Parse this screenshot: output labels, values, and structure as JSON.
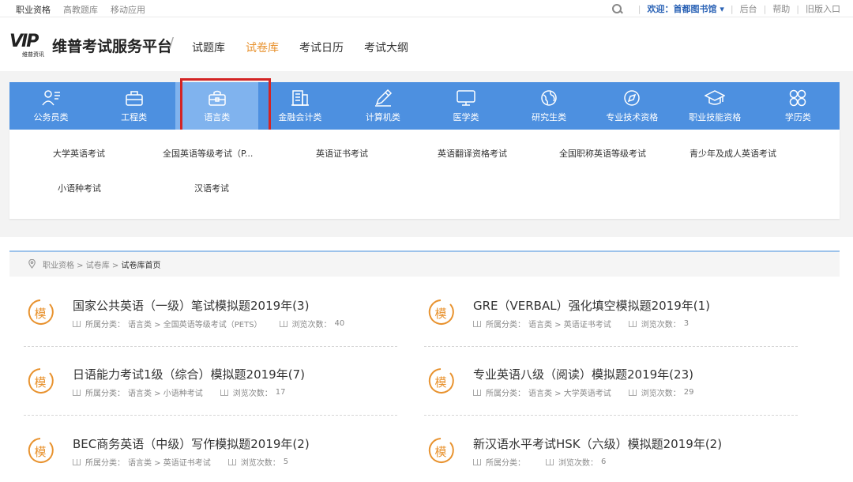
{
  "topbar": {
    "links": [
      "职业资格",
      "高教题库",
      "移动应用"
    ],
    "welcome": "欢迎：首都图书馆 ▾",
    "right_links": [
      "后台",
      "帮助",
      "旧版入口"
    ]
  },
  "header": {
    "logo_text": "VIP",
    "logo_sub": "维普资讯",
    "title": "维普考试服务平台",
    "slash": "/",
    "nav": [
      "试题库",
      "试卷库",
      "考试日历",
      "考试大纲"
    ],
    "nav_active_index": 1
  },
  "categories": {
    "items": [
      {
        "label": "公务员类",
        "icon": "person-list-icon"
      },
      {
        "label": "工程类",
        "icon": "toolbox-icon"
      },
      {
        "label": "语言类",
        "icon": "briefcase-icon"
      },
      {
        "label": "金融会计类",
        "icon": "bank-icon"
      },
      {
        "label": "计算机类",
        "icon": "pencil-icon"
      },
      {
        "label": "医学类",
        "icon": "monitor-icon"
      },
      {
        "label": "研究生类",
        "icon": "globe-icon"
      },
      {
        "label": "专业技术资格",
        "icon": "compass-icon"
      },
      {
        "label": "职业技能资格",
        "icon": "graduation-cap-icon"
      },
      {
        "label": "学历类",
        "icon": "four-circles-icon"
      }
    ],
    "selected_index": 2,
    "subcategories": [
      "大学英语考试",
      "全国英语等级考试（P...",
      "英语证书考试",
      "英语翻译资格考试",
      "全国职称英语等级考试",
      "青少年及成人英语考试",
      "小语种考试",
      "汉语考试"
    ]
  },
  "breadcrumb": {
    "items": [
      "职业资格",
      "试卷库"
    ],
    "current": "试卷库首页",
    "sep": " > "
  },
  "papers": {
    "badge_char": "模",
    "cat_label": "所属分类：",
    "views_label": "浏览次数：",
    "items": [
      {
        "title": "国家公共英语（一级）笔试模拟题2019年(3)",
        "category": "语言类 > 全国英语等级考试（PETS）",
        "views": "40"
      },
      {
        "title": "GRE（VERBAL）强化填空模拟题2019年(1)",
        "category": "语言类 > 英语证书考试",
        "views": "3"
      },
      {
        "title": "日语能力考试1级（综合）模拟题2019年(7)",
        "category": "语言类 > 小语种考试",
        "views": "17"
      },
      {
        "title": "专业英语八级（阅读）模拟题2019年(23)",
        "category": "语言类 > 大学英语考试",
        "views": "29"
      },
      {
        "title": "BEC商务英语（中级）写作模拟题2019年(2)",
        "category": "语言类 > 英语证书考试",
        "views": "5"
      },
      {
        "title": "新汉语水平考试HSK（六级）模拟题2019年(2)",
        "category": "",
        "views": "6"
      }
    ]
  },
  "colors": {
    "accent_blue": "#4d90e0",
    "selected_blue": "#80b3ee",
    "highlight_red": "#d32424",
    "active_nav_orange": "#e8922e",
    "badge_orange": "#e8922e"
  }
}
